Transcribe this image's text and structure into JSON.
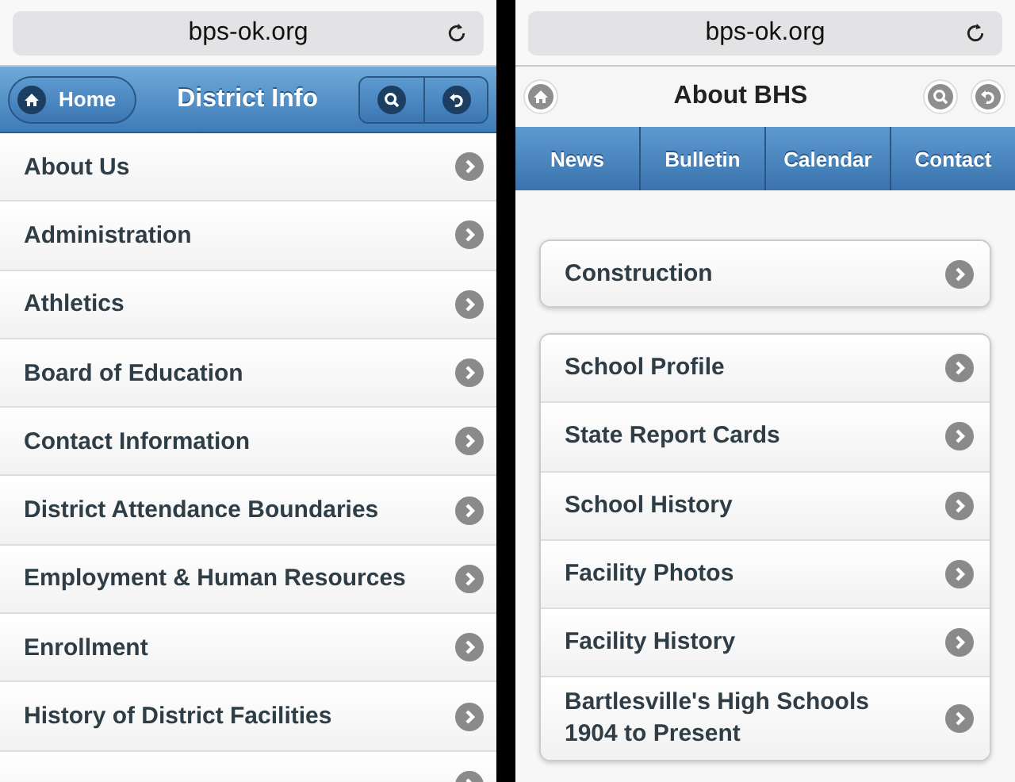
{
  "left_screen": {
    "url": "bps-ok.org",
    "header": {
      "home_button": "Home",
      "title": "District Info"
    },
    "items": [
      "About Us",
      "Administration",
      "Athletics",
      "Board of Education",
      "Contact Information",
      "District Attendance Boundaries",
      "Employment & Human Resources",
      "Enrollment",
      "History of District Facilities"
    ]
  },
  "right_screen": {
    "url": "bps-ok.org",
    "header": {
      "title": "About BHS"
    },
    "tabs": [
      {
        "label": "News",
        "selected": false
      },
      {
        "label": "Bulletin",
        "selected": false
      },
      {
        "label": "Calendar",
        "selected": false
      },
      {
        "label": "Contact",
        "selected": false
      }
    ],
    "groups": [
      [
        "Construction"
      ],
      [
        "School Profile",
        "State Report Cards",
        "School History",
        "Facility Photos",
        "Facility History",
        "Bartlesville's High Schools 1904 to Present"
      ]
    ]
  }
}
